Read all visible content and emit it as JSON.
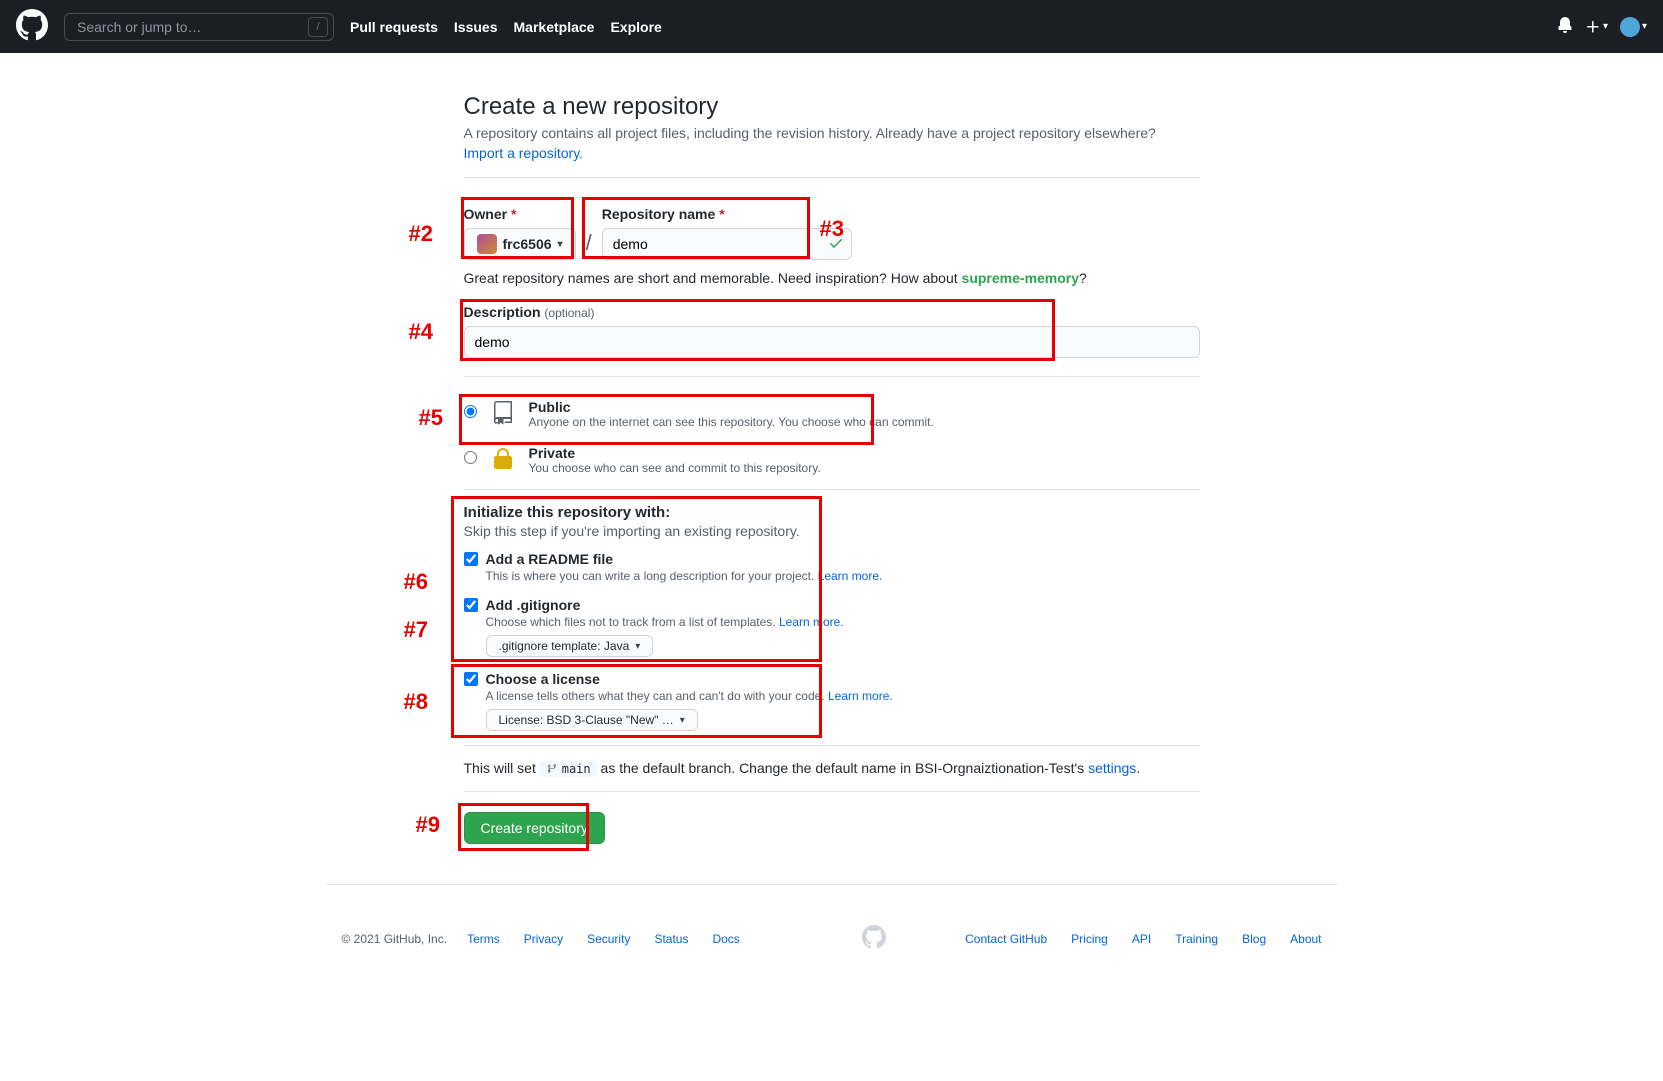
{
  "header": {
    "search_placeholder": "Search or jump to…",
    "search_slash": "/",
    "nav": {
      "pulls": "Pull requests",
      "issues": "Issues",
      "marketplace": "Marketplace",
      "explore": "Explore"
    }
  },
  "page": {
    "title": "Create a new repository",
    "subhead": "A repository contains all project files, including the revision history. Already have a project repository elsewhere?",
    "import_link": "Import a repository."
  },
  "owner": {
    "label": "Owner",
    "selected": "frc6506"
  },
  "repo_name": {
    "label": "Repository name",
    "value": "demo"
  },
  "name_hint": {
    "before": "Great repository names are short and memorable. Need inspiration? How about ",
    "suggestion": "supreme-memory",
    "after": "?"
  },
  "description": {
    "label": "Description",
    "optional": "(optional)",
    "value": "demo"
  },
  "visibility": {
    "public": {
      "title": "Public",
      "desc": "Anyone on the internet can see this repository. You choose who can commit."
    },
    "private": {
      "title": "Private",
      "desc": "You choose who can see and commit to this repository."
    }
  },
  "init": {
    "title": "Initialize this repository with:",
    "sub": "Skip this step if you're importing an existing repository.",
    "readme": {
      "label": "Add a README file",
      "desc_before": "This is where you can write a long description for your project. ",
      "learn": "Learn more."
    },
    "gitignore": {
      "label": "Add .gitignore",
      "desc_before": "Choose which files not to track from a list of templates. ",
      "learn": "Learn more.",
      "select": ".gitignore template: Java"
    },
    "license": {
      "label": "Choose a license",
      "desc_before": "A license tells others what they can and can't do with your code. ",
      "learn": "Learn more.",
      "select": "License: BSD 3-Clause \"New\" …"
    }
  },
  "branch_note": {
    "before": "This will set ",
    "branch": "main",
    "mid": " as the default branch. Change the default name in BSI-Orgnaiztionation-Test's ",
    "settings": "settings",
    "after": "."
  },
  "create_button": "Create repository",
  "footer": {
    "copy": "© 2021 GitHub, Inc.",
    "left": {
      "terms": "Terms",
      "privacy": "Privacy",
      "security": "Security",
      "status": "Status",
      "docs": "Docs"
    },
    "right": {
      "contact": "Contact GitHub",
      "pricing": "Pricing",
      "api": "API",
      "training": "Training",
      "blog": "Blog",
      "about": "About"
    }
  },
  "annotations": {
    "a2": "#2",
    "a3": "#3",
    "a4": "#4",
    "a5": "#5",
    "a6": "#6",
    "a7": "#7",
    "a8": "#8",
    "a9": "#9"
  }
}
